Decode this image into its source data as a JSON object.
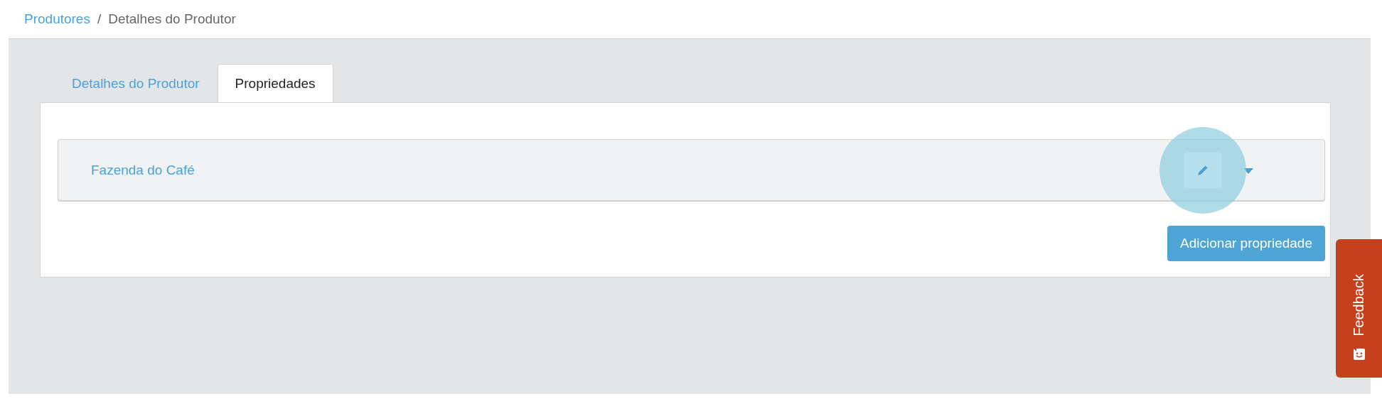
{
  "breadcrumb": [
    {
      "label": "Produtores",
      "kind": "link"
    },
    {
      "label": "/",
      "kind": "separator"
    },
    {
      "label": "Detalhes do Produtor",
      "kind": "current"
    }
  ],
  "tabs": [
    {
      "label": "Detalhes do Produtor",
      "selected": false
    },
    {
      "label": "Propriedades",
      "selected": true
    }
  ],
  "properties": [
    {
      "name": "Fazenda do Café"
    }
  ],
  "add_button": "Adicionar propriedade",
  "feedback": "Feedback"
}
